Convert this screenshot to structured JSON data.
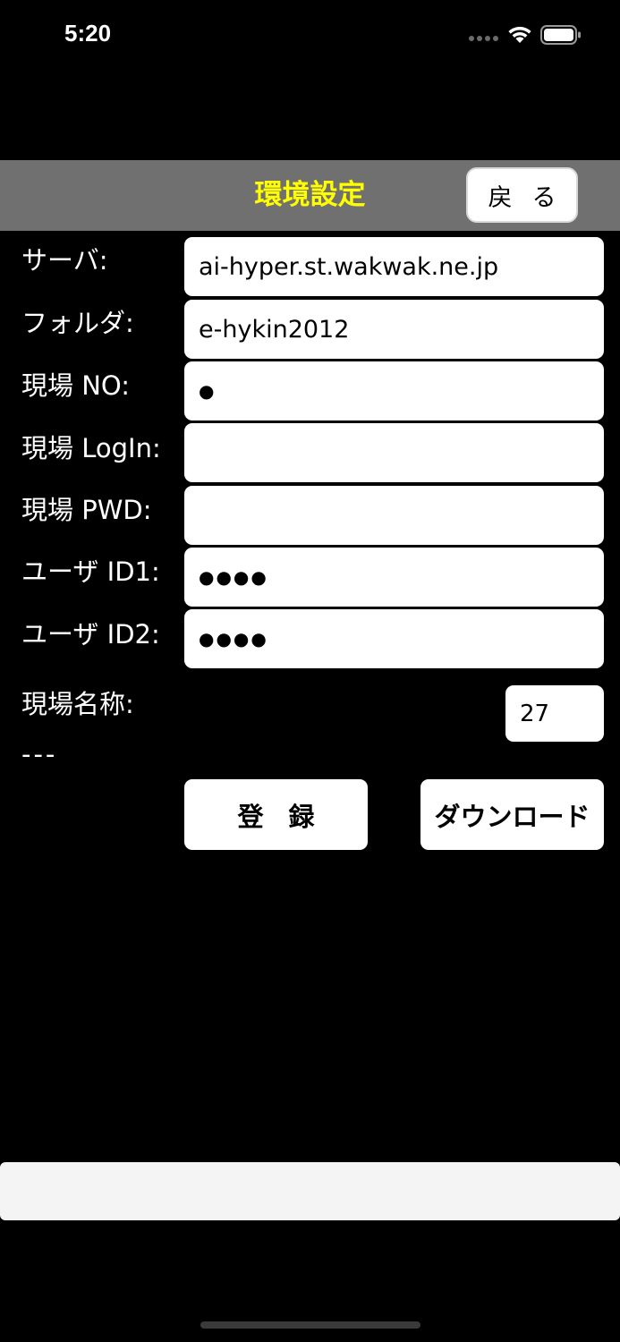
{
  "status_bar": {
    "time": "5:20"
  },
  "header": {
    "title": "環境設定",
    "back_label": "戻る",
    "title_color": "#ffff00",
    "background": "#707070"
  },
  "form": {
    "server": {
      "label": "サーバ:",
      "value": "ai-hyper.st.wakwak.ne.jp"
    },
    "folder": {
      "label": "フォルダ:",
      "value": "e-hykin2012"
    },
    "site_no": {
      "label": "現場 NO:",
      "value": "●"
    },
    "site_login": {
      "label": "現場 LogIn:",
      "value": ""
    },
    "site_pwd": {
      "label": "現場 PWD:",
      "value": ""
    },
    "user_id1": {
      "label": "ユーザ ID1:",
      "value": "●●●●"
    },
    "user_id2": {
      "label": "ユーザ ID2:",
      "value": "●●●●"
    },
    "site_name": {
      "label": "現場名称:",
      "value": "---"
    },
    "count_value": "27"
  },
  "buttons": {
    "register_label": "登録",
    "download_label": "ダウンロード"
  }
}
